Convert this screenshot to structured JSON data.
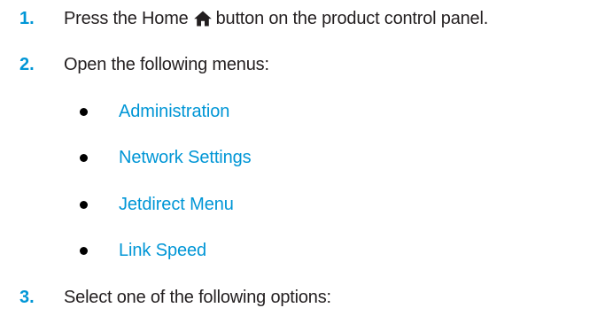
{
  "steps": [
    {
      "number": "1.",
      "text_before_icon": "Press the Home",
      "icon": "home-icon",
      "text_after_icon": "button on the product control panel."
    },
    {
      "number": "2.",
      "text": "Open the following menus:"
    },
    {
      "number": "3.",
      "text": "Select one of the following options:"
    }
  ],
  "menus": [
    "Administration",
    "Network Settings",
    "Jetdirect Menu",
    "Link Speed"
  ],
  "colors": {
    "accent": "#0096d6",
    "text": "#231f20",
    "bullet": "#000000"
  }
}
